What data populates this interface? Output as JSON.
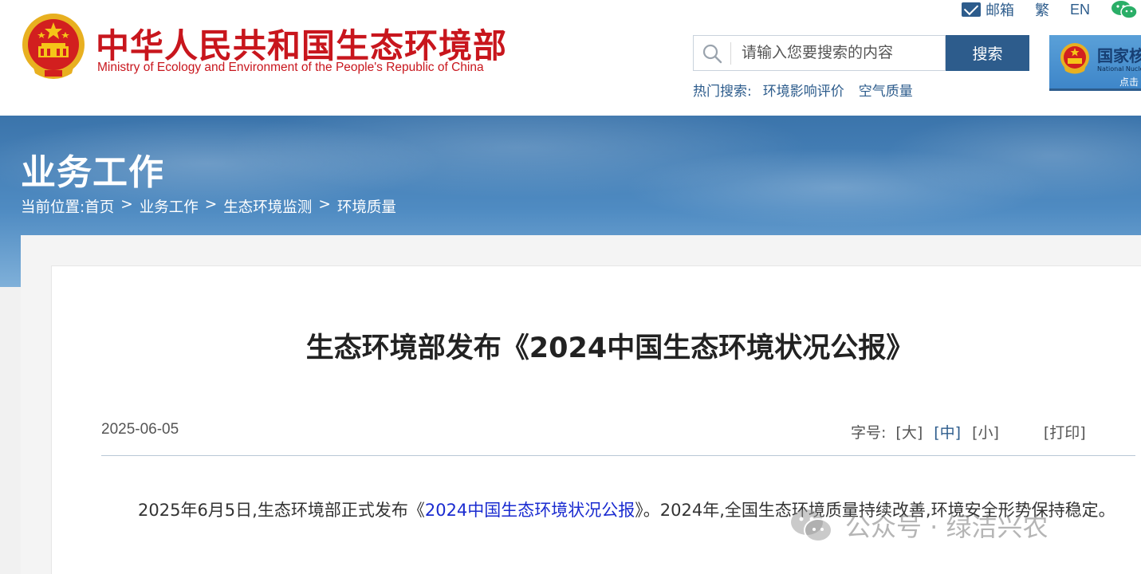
{
  "header": {
    "site_title_cn": "中华人民共和国生态环境部",
    "site_title_en": "Ministry of Ecology and Environment of the People's Republic of China",
    "top_links": {
      "mail": "邮箱",
      "traditional": "繁",
      "english": "EN"
    },
    "search": {
      "placeholder": "请输入您要搜索的内容",
      "button": "搜索"
    },
    "hot_search": {
      "label": "热门搜索:",
      "items": [
        "环境影响评价",
        "空气质量"
      ]
    },
    "banner_ad": {
      "title": "国家核",
      "subtitle": "National Nuclear",
      "click": "点击"
    },
    "colors": {
      "brand_red": "#c8161d",
      "brand_blue": "#2d5c8c"
    }
  },
  "section": {
    "title": "业务工作",
    "breadcrumb": [
      "当前位置:",
      "首页",
      "业务工作",
      "生态环境监测",
      "环境质量"
    ],
    "breadcrumb_sep": ">"
  },
  "article": {
    "title": "生态环境部发布《2024中国生态环境状况公报》",
    "date": "2025-06-05",
    "font_size_label": "字号:",
    "font_size_options": [
      "[大]",
      "[中]",
      "[小]"
    ],
    "font_size_selected": "[中]",
    "print": "[打印]",
    "body_pre": "2025年6月5日,生态环境部正式发布《",
    "body_link": "2024中国生态环境状况公报",
    "body_post": "》。2024年,全国生态环境质量持续改善,环境安全形势保持稳定。"
  },
  "watermark": {
    "text": "公众号 · 绿洁兴农"
  }
}
